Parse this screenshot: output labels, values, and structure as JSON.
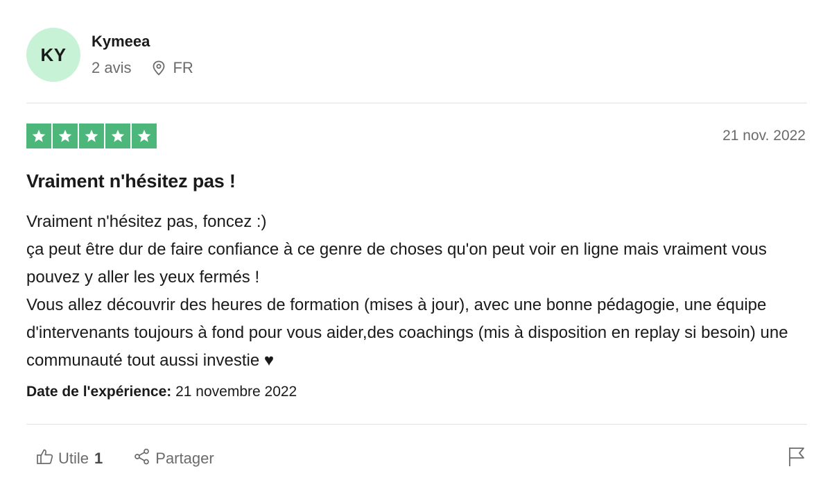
{
  "reviewer": {
    "initials": "KY",
    "name": "Kymeea",
    "review_count": "2 avis",
    "country": "FR",
    "avatar_color": "#c8f2d6"
  },
  "review": {
    "rating": 5,
    "rating_max": 5,
    "star_color": "#4db77b",
    "date": "21 nov. 2022",
    "title": "Vraiment n'hésitez pas !",
    "body_lines": [
      "Vraiment n'hésitez pas, foncez :)",
      "ça peut être dur de faire confiance à ce genre de choses qu'on peut voir en ligne mais vraiment vous pouvez y aller les yeux fermés !",
      "Vous allez découvrir des heures de formation (mises à jour), avec une bonne pédagogie, une équipe d'intervenants toujours à fond pour vous aider,des coachings (mis à disposition en replay si besoin) une communauté tout aussi investie ♥"
    ],
    "experience_label": "Date de l'expérience:",
    "experience_date": "21 novembre 2022"
  },
  "actions": {
    "useful_label": "Utile",
    "useful_count": "1",
    "share_label": "Partager",
    "icons": [
      "thumbs-up-icon",
      "share-icon",
      "flag-icon",
      "location-pin-icon",
      "star-icon"
    ]
  }
}
